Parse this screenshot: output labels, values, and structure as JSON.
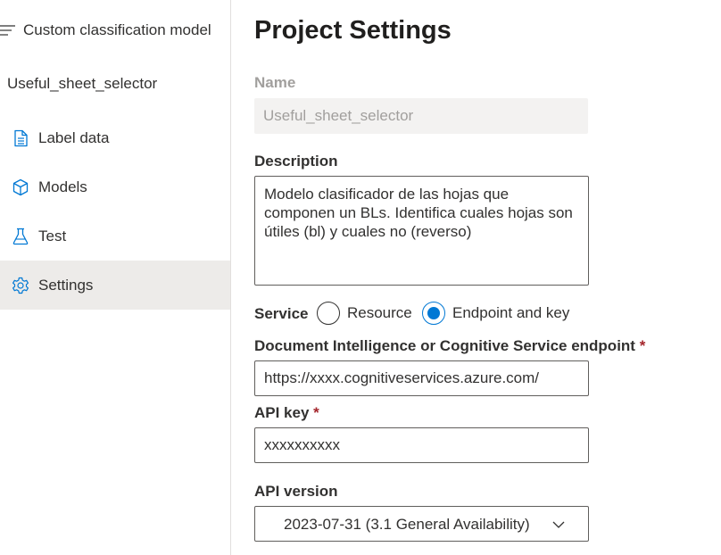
{
  "sidebar": {
    "title": "Custom classification model",
    "project_name": "Useful_sheet_selector",
    "items": [
      {
        "label": "Label data",
        "icon": "document-icon"
      },
      {
        "label": "Models",
        "icon": "cube-icon"
      },
      {
        "label": "Test",
        "icon": "flask-icon"
      },
      {
        "label": "Settings",
        "icon": "gear-icon",
        "selected": true
      }
    ]
  },
  "main": {
    "title": "Project Settings",
    "name": {
      "label": "Name",
      "value": "Useful_sheet_selector"
    },
    "description": {
      "label": "Description",
      "value": "Modelo clasificador de las hojas que componen un BLs. Identifica cuales hojas son útiles (bl) y cuales no (reverso)"
    },
    "service": {
      "label": "Service",
      "options": [
        "Resource",
        "Endpoint and key"
      ],
      "selected": "Endpoint and key"
    },
    "endpoint": {
      "label": "Document Intelligence or Cognitive Service endpoint",
      "required_mark": "*",
      "value": "https://xxxx.cognitiveservices.azure.com/"
    },
    "api_key": {
      "label": "API key",
      "required_mark": "*",
      "value": "xxxxxxxxxx"
    },
    "api_version": {
      "label": "API version",
      "value": "2023-07-31 (3.1 General Availability)"
    }
  },
  "colors": {
    "accent": "#0078d4",
    "required": "#a4262c",
    "selected_nav_bg": "#edebe9",
    "disabled_bg": "#f3f2f1"
  }
}
